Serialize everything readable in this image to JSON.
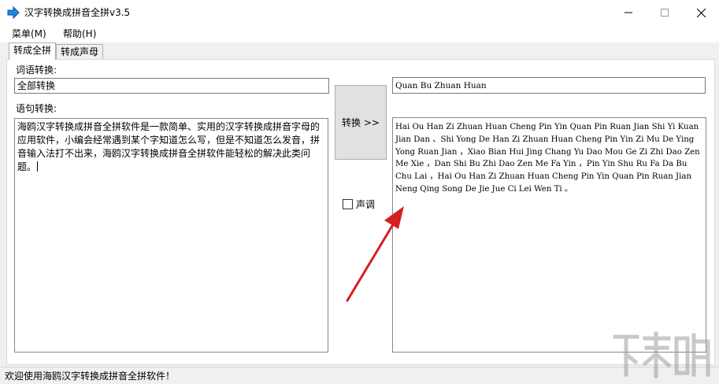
{
  "window": {
    "title": "汉字转换成拼音全拼v3.5",
    "icon": "blue-arrow-right-icon"
  },
  "menu": {
    "items": [
      {
        "label": "菜单(M)"
      },
      {
        "label": "帮助(H)"
      }
    ]
  },
  "tabs": [
    {
      "label": "转成全拼",
      "active": true
    },
    {
      "label": "转成声母",
      "active": false
    }
  ],
  "word": {
    "label": "词语转换:",
    "input_value": "全部转换",
    "output_value": "Quan Bu Zhuan Huan"
  },
  "sentence": {
    "label": "语句转换:",
    "input_value": "海鸥汉字转换成拼音全拼软件是一款简单、实用的汉字转换成拼音字母的应用软件，小编会经常遇到某个字知道怎么写，但是不知道怎么发音，拼音输入法打不出来，海鸥汉字转换成拼音全拼软件能轻松的解决此类问题。",
    "output_value": "Hai Ou Han Zi Zhuan Huan Cheng Pin Yin Quan Pin Ruan Jian Shi Yi Kuan Jian Dan 、Shi Yong De Han Zi Zhuan Huan Cheng Pin Yin Zi Mu De Ying Yong Ruan Jian ，Xiao Bian Hui Jing Chang Yu Dao Mou Ge Zi Zhi Dao Zen Me Xie ，Dan Shi Bu Zhi Dao Zen Me Fa Yin ，Pin Yin Shu Ru Fa Da Bu Chu Lai ，Hai Ou Han Zi Zhuan Huan Cheng Pin Yin Quan Pin Ruan Jian Neng Qing Song De Jie Jue Ci Lei Wen Ti 。"
  },
  "convert_button": {
    "label": "转换 >>"
  },
  "tone_checkbox": {
    "label": "声调",
    "checked": false
  },
  "status": {
    "text": "欢迎使用海鸥汉字转换成拼音全拼软件！"
  },
  "colors": {
    "accent": "#0078d7",
    "arrow": "#e02020"
  }
}
